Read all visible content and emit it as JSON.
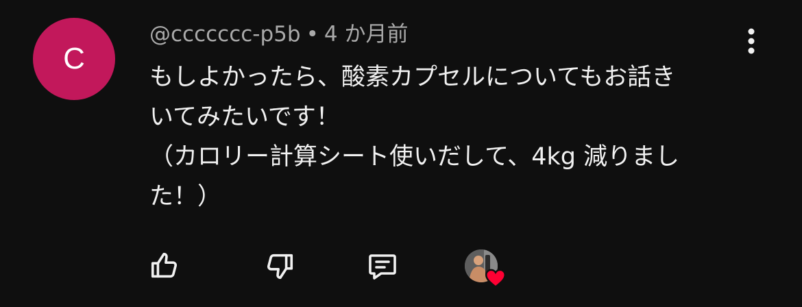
{
  "comment": {
    "avatar_letter": "C",
    "avatar_color": "#c2185b",
    "author": "@ccccccc-p5b",
    "separator": "•",
    "time": "4 か月前",
    "text": "もしよかったら、酸素カプセルについてもお話き\nいてみたいです！\n（カロリー計算シート使いだして、4kg 減りまし\nた！）"
  },
  "actions": {
    "like_icon": "thumbs-up-icon",
    "dislike_icon": "thumbs-down-icon",
    "reply_icon": "reply-comment-icon",
    "creator_heart_icon": "heart-icon",
    "menu_icon": "more-vertical-icon"
  },
  "colors": {
    "background": "#0f0f0f",
    "text": "#f1f1f1",
    "meta": "#aaaaaa",
    "heart": "#ff0033"
  }
}
